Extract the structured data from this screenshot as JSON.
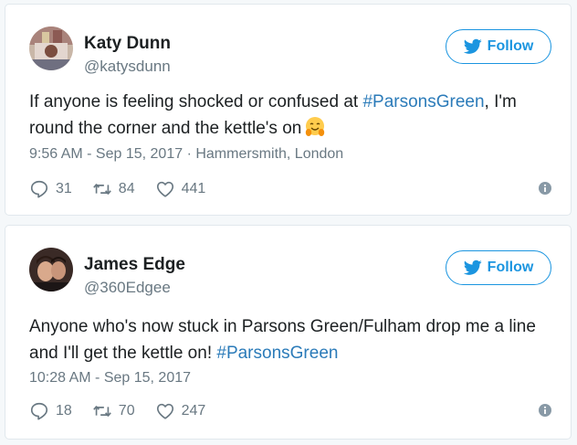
{
  "tweets": [
    {
      "name": "Katy Dunn",
      "handle": "@katysdunn",
      "follow_label": "Follow",
      "text_before": "If anyone is feeling shocked or confused at ",
      "hashtag": "#ParsonsGreen",
      "text_after": ", I'm round the corner and the kettle's on",
      "emoji": "hugging-face-emoji",
      "timestamp": "9:56 AM - Sep 15, 2017",
      "separator": " · ",
      "location": "Hammersmith, London",
      "replies": "31",
      "retweets": "84",
      "likes": "441"
    },
    {
      "name": "James Edge",
      "handle": "@360Edgee",
      "follow_label": "Follow",
      "text_before": "Anyone who's now stuck in Parsons Green/Fulham drop me a line and I'll get the kettle on! ",
      "hashtag": "#ParsonsGreen",
      "text_after": "",
      "timestamp": "10:28 AM - Sep 15, 2017",
      "replies": "18",
      "retweets": "70",
      "likes": "247"
    }
  ],
  "colors": {
    "accent": "#1b95e0",
    "hashtag": "#2b7bb9",
    "muted": "#697882",
    "text": "#1c2022",
    "border": "#e1e8ed"
  },
  "icons": [
    "twitter-bird-icon",
    "reply-icon",
    "retweet-icon",
    "like-heart-icon",
    "info-icon"
  ]
}
